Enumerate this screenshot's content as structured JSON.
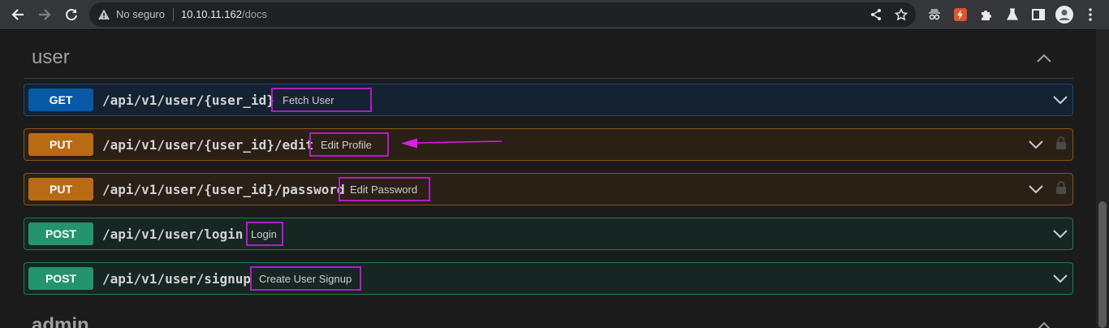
{
  "browser": {
    "insecure_label": "No seguro",
    "url_host": "10.10.11.162",
    "url_path": "/docs",
    "icons": [
      "back-icon",
      "forward-icon",
      "reload-icon",
      "warning-icon",
      "share-icon",
      "star-icon",
      "spy-extension-icon",
      "bolt-extension-icon",
      "puzzle-extensions-icon",
      "lab-flask-icon",
      "sidebar-icon",
      "profile-avatar-icon",
      "more-menu-icon"
    ]
  },
  "sections": [
    {
      "title": "user",
      "operations": [
        {
          "method": "GET",
          "path": "/api/v1/user/{user_id}",
          "summary": "Fetch User",
          "locked": false
        },
        {
          "method": "PUT",
          "path": "/api/v1/user/{user_id}/edit",
          "summary": "Edit Profile",
          "locked": true
        },
        {
          "method": "PUT",
          "path": "/api/v1/user/{user_id}/password",
          "summary": "Edit Password",
          "locked": true
        },
        {
          "method": "POST",
          "path": "/api/v1/user/login",
          "summary": "Login",
          "locked": false
        },
        {
          "method": "POST",
          "path": "/api/v1/user/signup",
          "summary": "Create User Signup",
          "locked": false
        }
      ]
    },
    {
      "title": "admin"
    }
  ],
  "annotation": {
    "color": "#e01ae6"
  },
  "colors": {
    "get": "#0759a6",
    "put": "#b86b14",
    "post": "#24946e",
    "highlight": "#b21cc6"
  }
}
